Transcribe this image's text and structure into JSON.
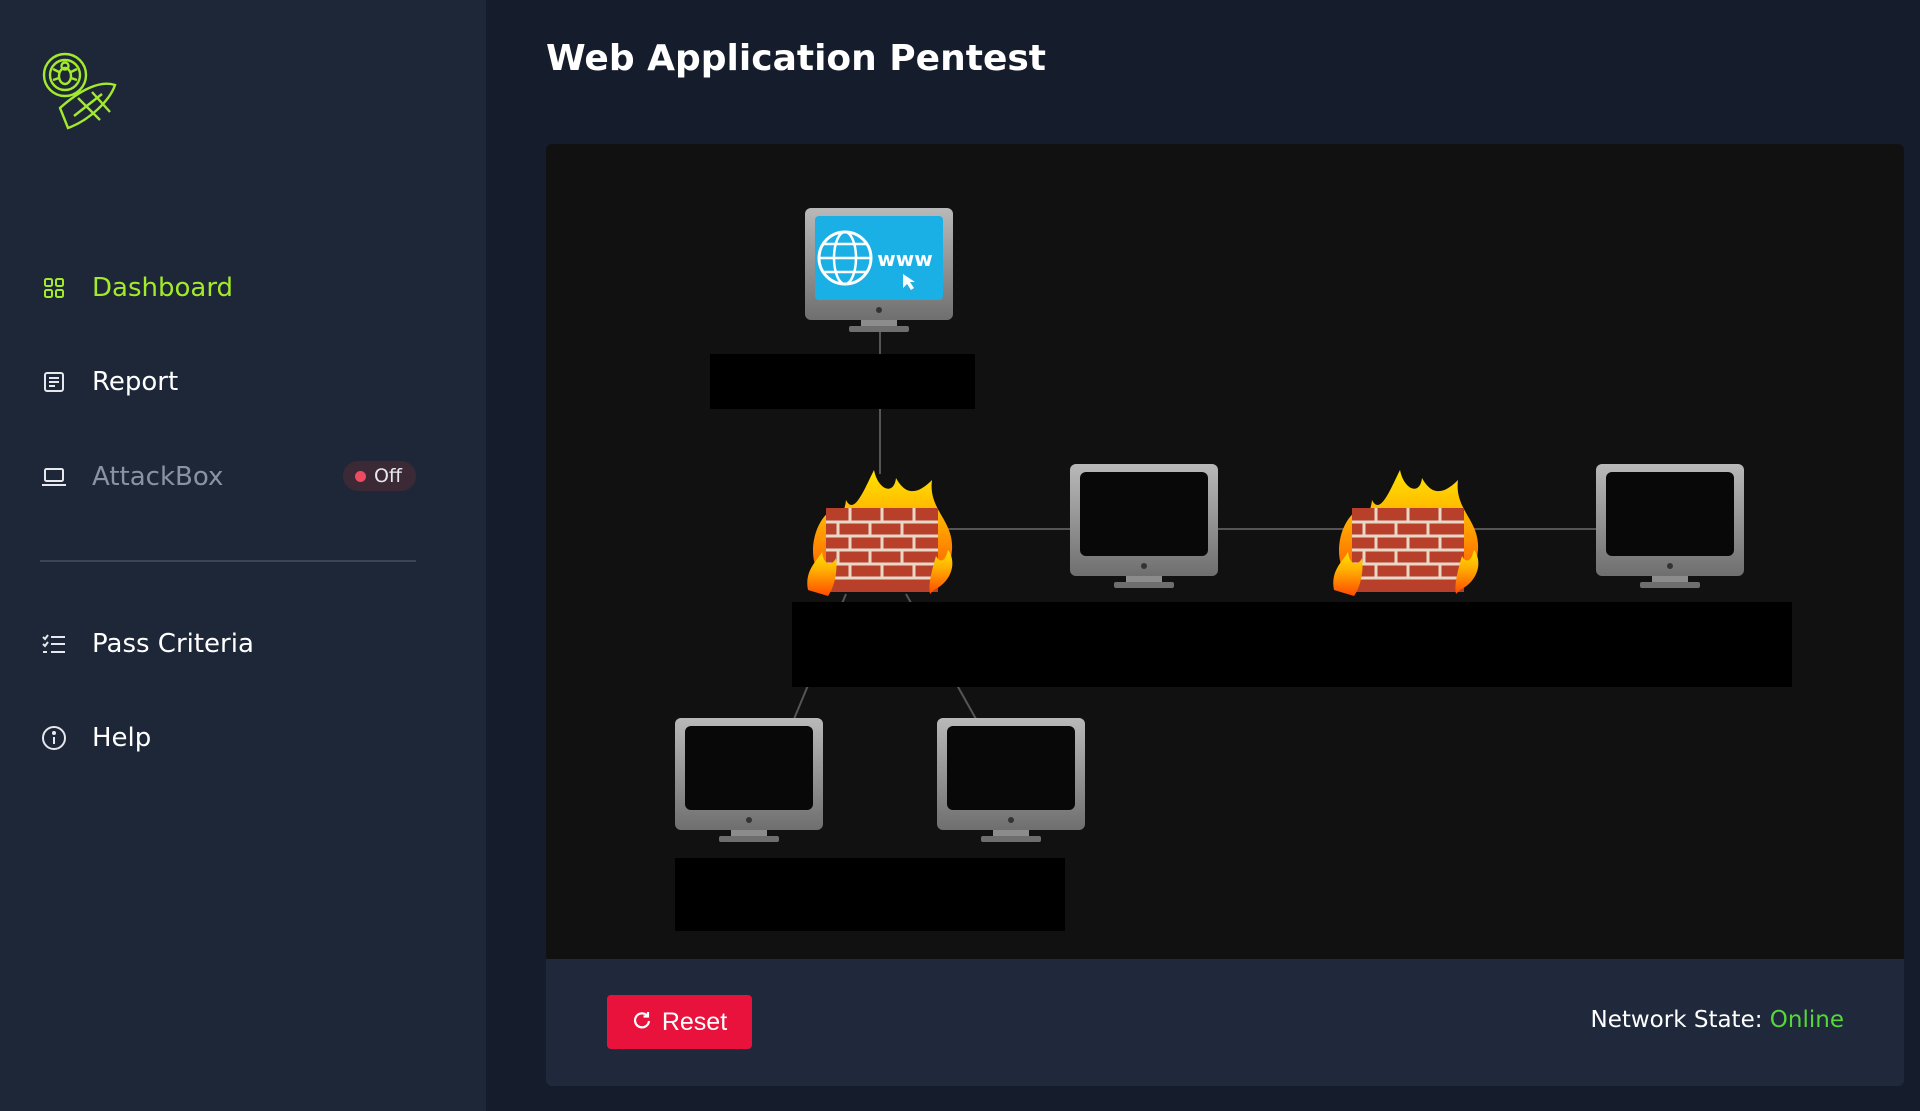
{
  "page": {
    "title": "Web Application Pentest"
  },
  "sidebar": {
    "items": [
      {
        "label": "Dashboard",
        "icon": "grid-icon"
      },
      {
        "label": "Report",
        "icon": "report-icon"
      },
      {
        "label": "AttackBox",
        "icon": "laptop-icon",
        "badge": "Off"
      },
      {
        "label": "Pass Criteria",
        "icon": "checklist-icon"
      },
      {
        "label": "Help",
        "icon": "info-icon"
      }
    ]
  },
  "footer": {
    "reset_label": "Reset",
    "network_state_label": "Network State:",
    "network_state_value": "Online"
  },
  "colors": {
    "accent": "#a3ea2a",
    "reset": "#e8123c",
    "online": "#56d63a",
    "badge_dot": "#ef4a5f"
  }
}
